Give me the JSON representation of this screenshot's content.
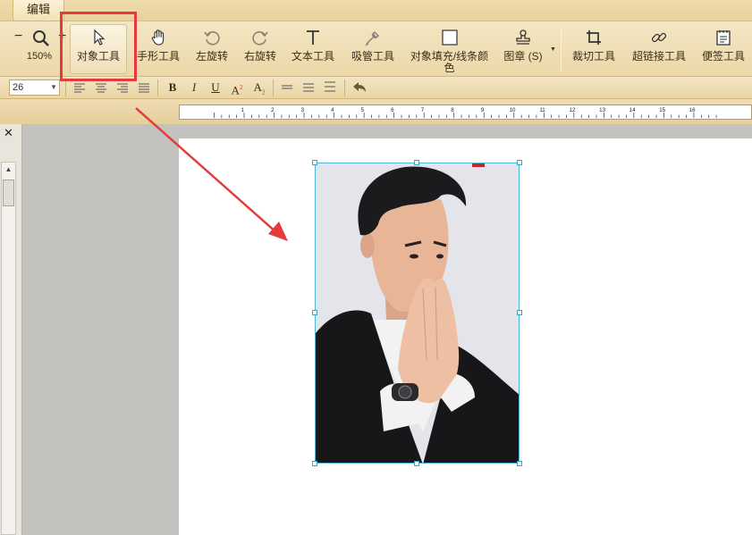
{
  "tabs": {
    "active": "编辑"
  },
  "zoom": {
    "value": "150%",
    "minus": "−",
    "plus": "+"
  },
  "toolbar": {
    "object_tool": "对象工具",
    "hand_tool": "手形工具",
    "rotate_left": "左旋转",
    "rotate_right": "右旋转",
    "text_tool": "文本工具",
    "eyedropper": "吸管工具",
    "fill_color": "对象填充/线条颜色",
    "stamp": "图章 (S)",
    "crop": "裁切工具",
    "hyperlink": "超链接工具",
    "sticky_note": "便签工具"
  },
  "format": {
    "font_size": "26",
    "bold": "B",
    "italic": "I",
    "underline": "U",
    "superscript_base": "A",
    "superscript_mark": "2",
    "subscript_base": "A",
    "subscript_mark": "2"
  },
  "ruler": {
    "ticks": [
      "1",
      "2",
      "3",
      "4",
      "5",
      "6",
      "7",
      "8",
      "9",
      "10",
      "11",
      "12",
      "13",
      "14",
      "15",
      "16"
    ]
  },
  "panel": {
    "close": "✕",
    "scroll_up": "▲"
  },
  "colors": {
    "highlight": "#e53b3b",
    "selection": "#3aa4c8",
    "ribbon": "#ecd8a8"
  }
}
